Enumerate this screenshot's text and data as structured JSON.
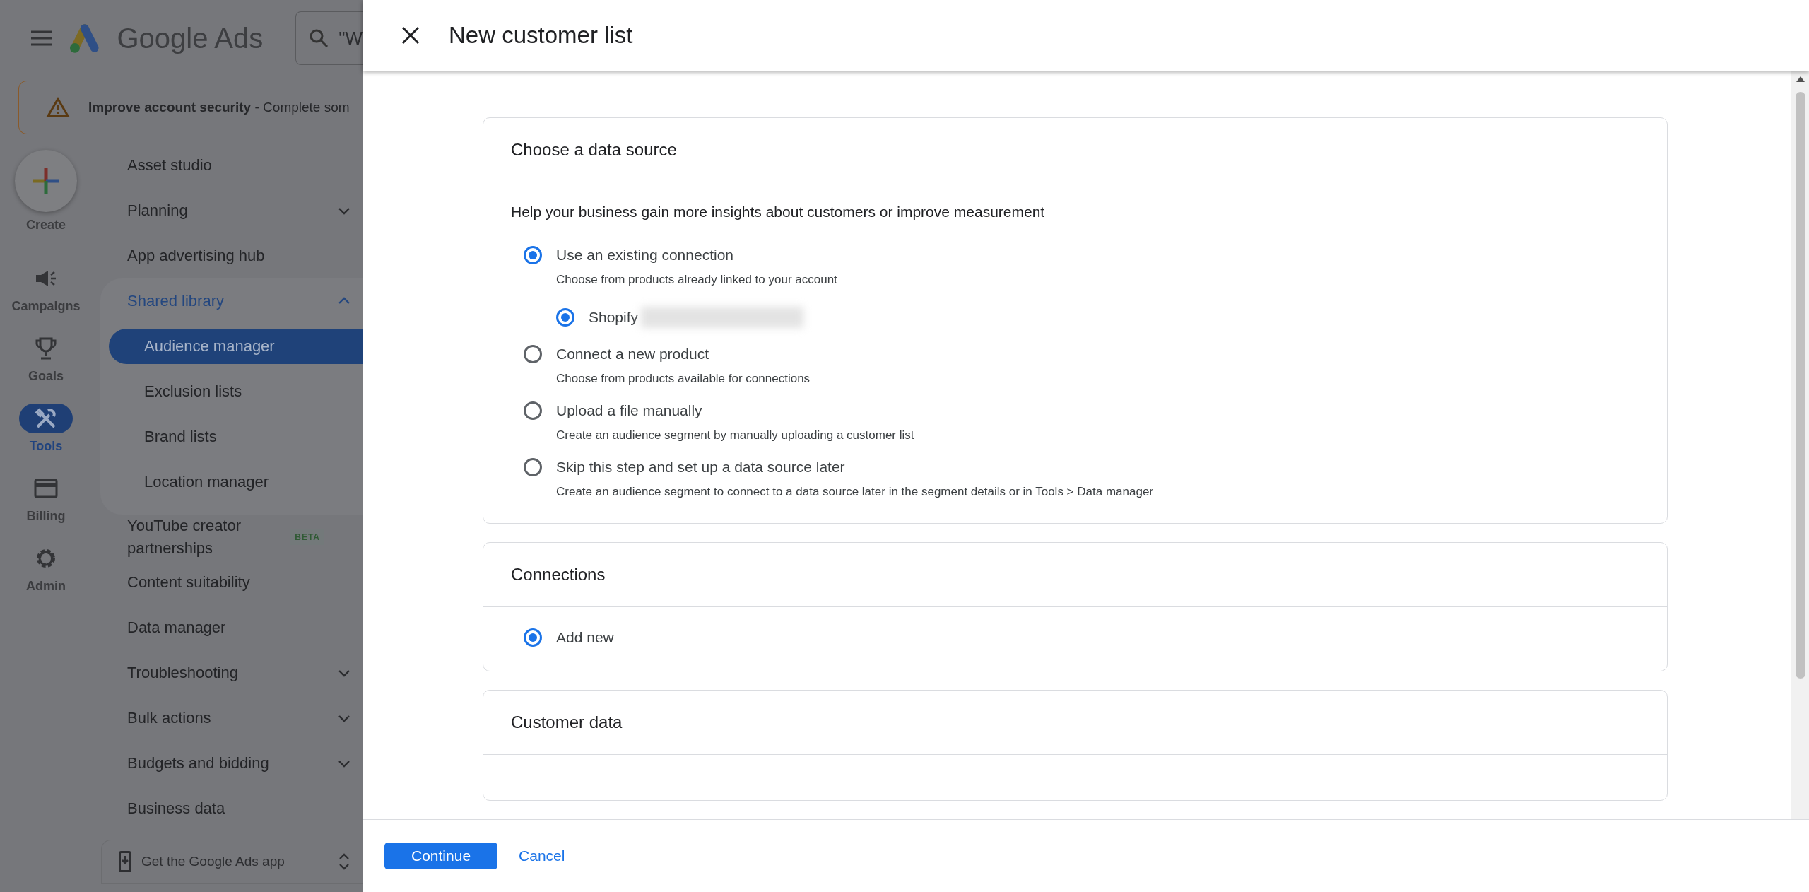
{
  "app": {
    "product_name": "Google Ads",
    "search": {
      "value": "\"W"
    },
    "alert": {
      "text": "**Improve account security** - Complete som"
    },
    "rail": [
      {
        "kind": "create",
        "label": "Create"
      },
      {
        "kind": "campaigns",
        "label": "Campaigns",
        "selected": false
      },
      {
        "kind": "goals",
        "label": "Goals",
        "selected": false
      },
      {
        "kind": "tools",
        "label": "Tools",
        "selected": true
      },
      {
        "kind": "billing",
        "label": "Billing",
        "selected": false
      },
      {
        "kind": "admin",
        "label": "Admin",
        "selected": false
      }
    ],
    "nav": [
      {
        "label": "Asset studio"
      },
      {
        "label": "Planning",
        "expanded": false
      },
      {
        "label": "App advertising hub"
      },
      {
        "label": "Shared library",
        "expanded": true,
        "children": [
          {
            "label": "Audience manager",
            "selected": true
          },
          {
            "label": "Exclusion lists",
            "selected": false
          },
          {
            "label": "Brand lists",
            "selected": false
          },
          {
            "label": "Location manager",
            "selected": false
          }
        ]
      },
      {
        "label": "YouTube creator partnerships",
        "badge": "BETA"
      },
      {
        "label": "Content suitability"
      },
      {
        "label": "Data manager"
      },
      {
        "label": "Troubleshooting",
        "expanded": false
      },
      {
        "label": "Bulk actions",
        "expanded": false
      },
      {
        "label": "Budgets and bidding",
        "expanded": false
      },
      {
        "label": "Business data"
      }
    ],
    "app_promo": "Get the Google Ads app"
  },
  "panel": {
    "title": "New customer list",
    "sections": [
      {
        "title": "Choose a data source",
        "intro": "Help your business gain more insights about customers or improve measurement",
        "options": [
          {
            "label": "Use an existing connection",
            "description": "Choose from products already linked to your account",
            "selected": true,
            "children": [
              {
                "label": "Shopify",
                "redacted": true,
                "selected": true
              }
            ]
          },
          {
            "label": "Connect a new product",
            "description": "Choose from products available for connections",
            "selected": false
          },
          {
            "label": "Upload a file manually",
            "description": "Create an audience segment by manually uploading a customer list",
            "selected": false
          },
          {
            "label": "Skip this step and set up a data source later",
            "description": "Create an audience segment to connect to a data source later in the segment details or in Tools > Data manager",
            "selected": false
          }
        ]
      },
      {
        "title": "Connections",
        "options": [
          {
            "label": "Add new",
            "selected": true
          }
        ]
      },
      {
        "title": "Customer data"
      }
    ],
    "buttons": [
      {
        "kind": "primary",
        "label": "Continue"
      },
      {
        "kind": "link",
        "label": "Cancel"
      }
    ]
  }
}
